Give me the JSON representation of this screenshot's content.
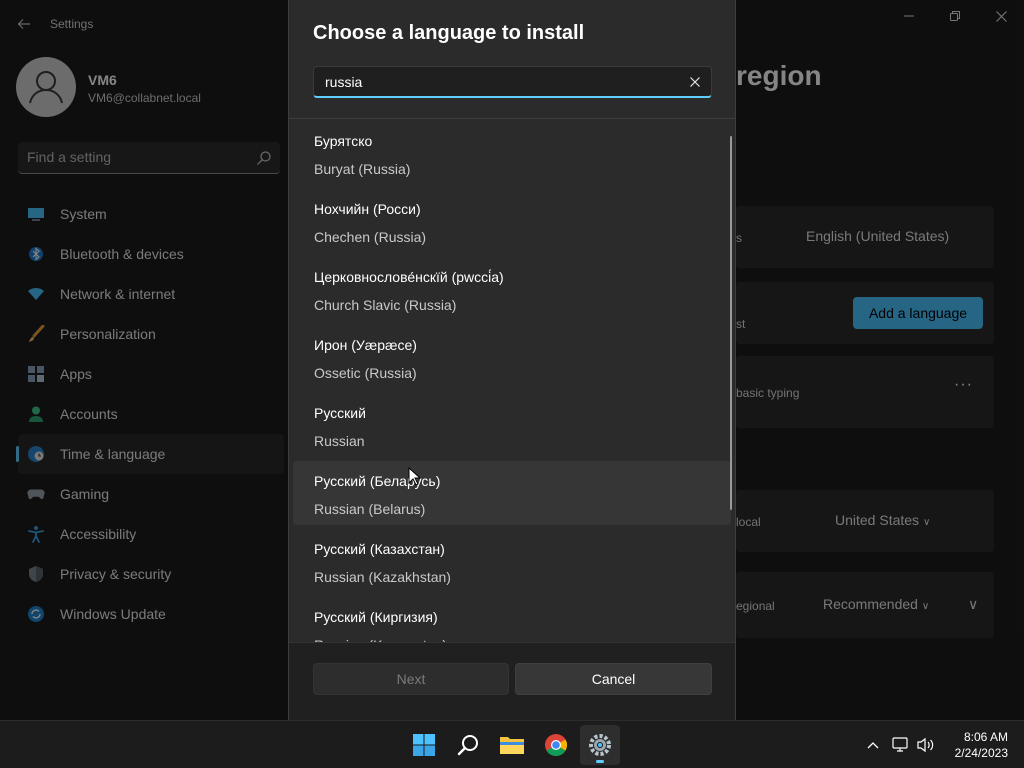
{
  "settings": {
    "app_title": "Settings",
    "profile": {
      "name": "VM6",
      "email": "VM6@collabnet.local"
    },
    "search_placeholder": "Find a setting",
    "nav": [
      {
        "label": "System",
        "icon": "monitor-icon",
        "active": false
      },
      {
        "label": "Bluetooth & devices",
        "icon": "bluetooth-icon",
        "active": false
      },
      {
        "label": "Network & internet",
        "icon": "wifi-icon",
        "active": false
      },
      {
        "label": "Personalization",
        "icon": "paintbrush-icon",
        "active": false
      },
      {
        "label": "Apps",
        "icon": "apps-icon",
        "active": false
      },
      {
        "label": "Accounts",
        "icon": "person-icon",
        "active": false
      },
      {
        "label": "Time & language",
        "icon": "globe-clock-icon",
        "active": true
      },
      {
        "label": "Gaming",
        "icon": "gamepad-icon",
        "active": false
      },
      {
        "label": "Accessibility",
        "icon": "accessibility-icon",
        "active": false
      },
      {
        "label": "Privacy & security",
        "icon": "shield-icon",
        "active": false
      },
      {
        "label": "Windows Update",
        "icon": "update-icon",
        "active": false
      }
    ],
    "page_heading_fragment": "region",
    "display_language_value": "English (United States)",
    "display_language_label_fragment": "s",
    "preferred_label_fragment": "st",
    "add_language_label": "Add a language",
    "basic_typing_fragment": "basic typing",
    "country_label_fragment": "local",
    "country_value": "United States",
    "regional_label_fragment": "egional",
    "regional_value": "Recommended"
  },
  "dialog": {
    "title": "Choose a language to install",
    "search_value": "russia",
    "languages": [
      {
        "native": "Бурятско",
        "english": "Buryat (Russia)"
      },
      {
        "native": "Нохчийн (Росси)",
        "english": "Chechen (Russia)"
      },
      {
        "native": "Церковнослове́нскїй (рwссі́а)",
        "english": "Church Slavic (Russia)"
      },
      {
        "native": "Ирон (Уæрæсе)",
        "english": "Ossetic (Russia)"
      },
      {
        "native": "Русский",
        "english": "Russian"
      },
      {
        "native": "Русский (Беларусь)",
        "english": "Russian (Belarus)",
        "hover": true
      },
      {
        "native": "Русский (Казахстан)",
        "english": "Russian (Kazakhstan)"
      },
      {
        "native": "Русский (Киргизия)",
        "english": "Russian (Kyrgyzstan)"
      }
    ],
    "next_label": "Next",
    "cancel_label": "Cancel"
  },
  "taskbar": {
    "apps": [
      "start-icon",
      "search-icon",
      "file-explorer-icon",
      "chrome-icon",
      "settings-gear-icon"
    ],
    "active_app": "settings-gear-icon",
    "time": "8:06 AM",
    "date": "2/24/2023"
  },
  "colors": {
    "accent": "#60cdff",
    "accent_button": "#4cc2ff",
    "dialog_bg": "#2b2b2b"
  }
}
